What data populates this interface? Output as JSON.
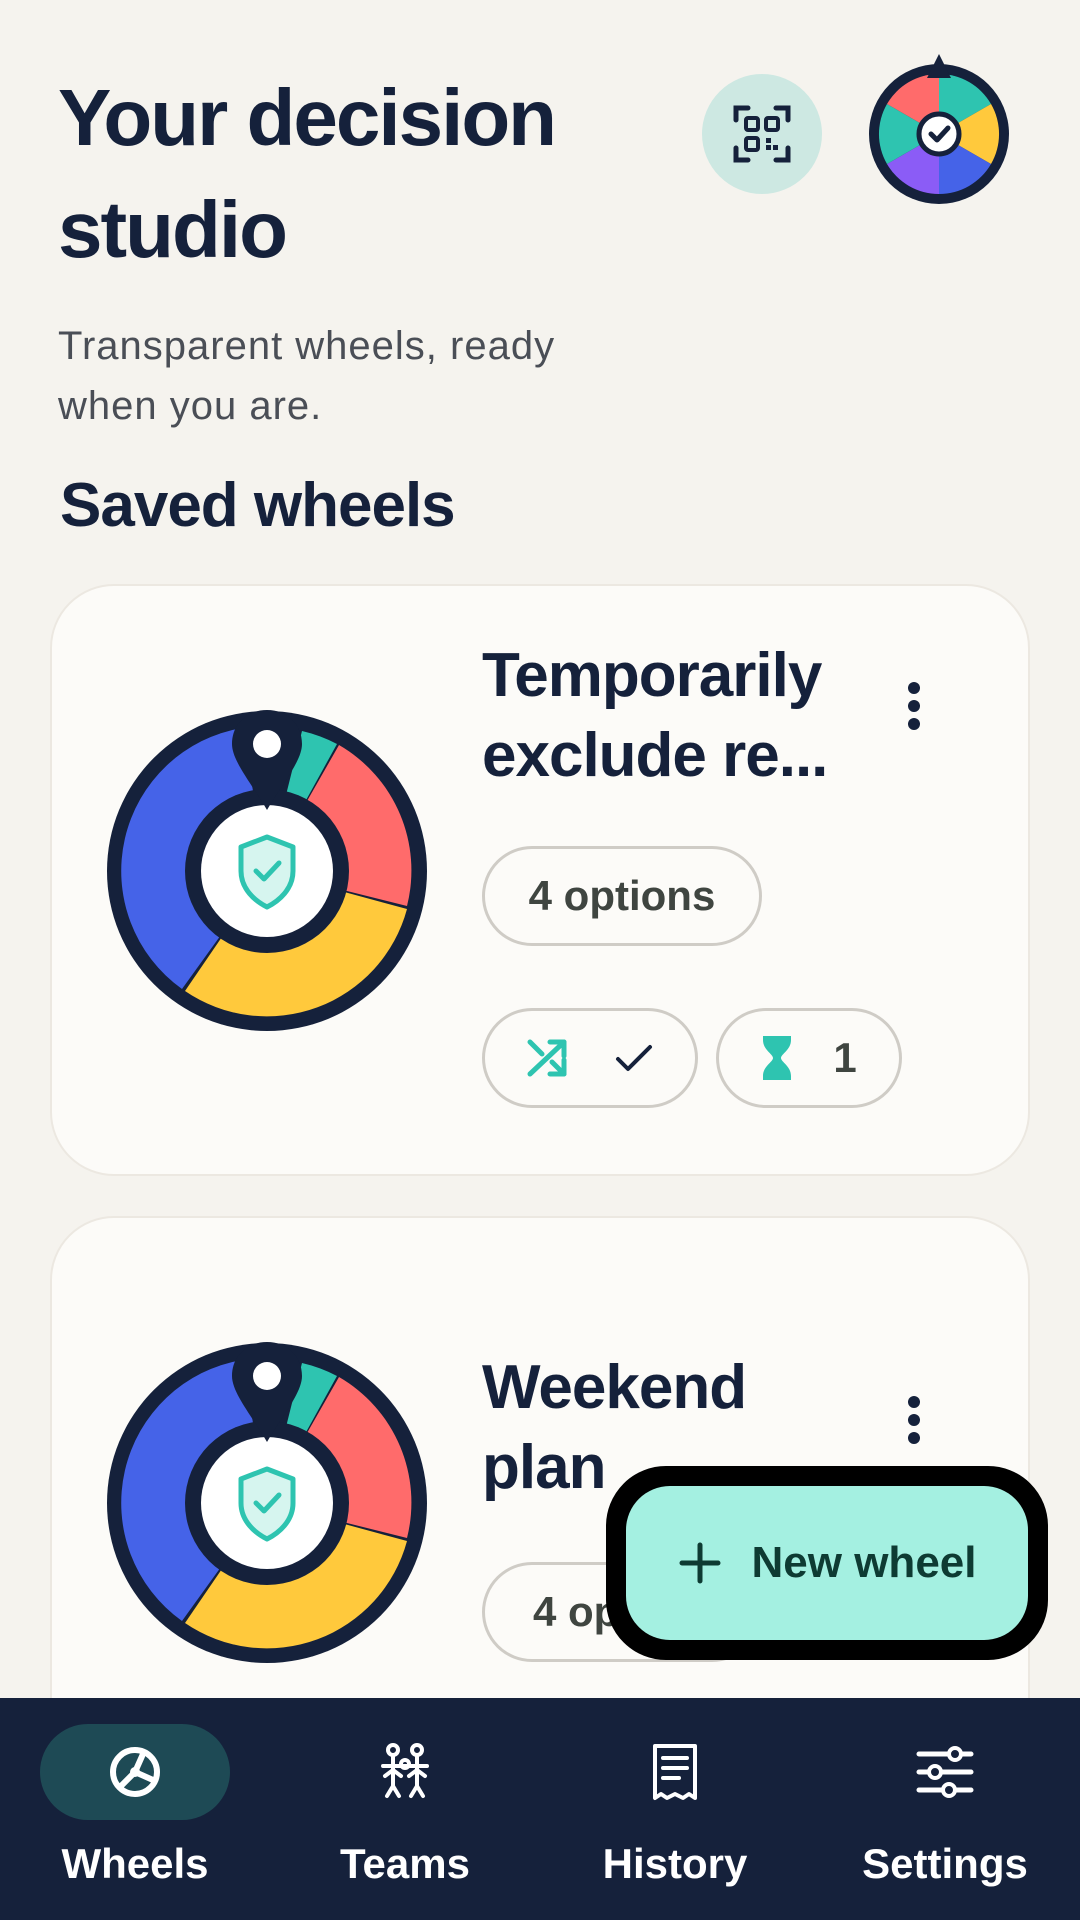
{
  "header": {
    "title": "Your decision studio",
    "subtitle": "Transparent wheels, ready when you are."
  },
  "section": {
    "title": "Saved wheels"
  },
  "wheels": [
    {
      "title": "Temporarily exclude re...",
      "options_label": "4 options",
      "exclude_count": "1"
    },
    {
      "title": "Weekend plan",
      "options_label": "4 op"
    }
  ],
  "fab": {
    "label": "New wheel"
  },
  "nav": {
    "items": [
      {
        "label": "Wheels",
        "icon": "wheel-icon",
        "active": true
      },
      {
        "label": "Teams",
        "icon": "teams-icon"
      },
      {
        "label": "History",
        "icon": "receipt-icon"
      },
      {
        "label": "Settings",
        "icon": "sliders-icon"
      }
    ]
  },
  "colors": {
    "background": "#F5F3EE",
    "ink": "#15213B",
    "accent_teal": "#2EC4B0",
    "fab": "#A4F0E1",
    "wheel_blue": "#4563E8",
    "wheel_red": "#FF6B6B",
    "wheel_yellow": "#FFC93C",
    "wheel_teal": "#2EC4B0"
  }
}
